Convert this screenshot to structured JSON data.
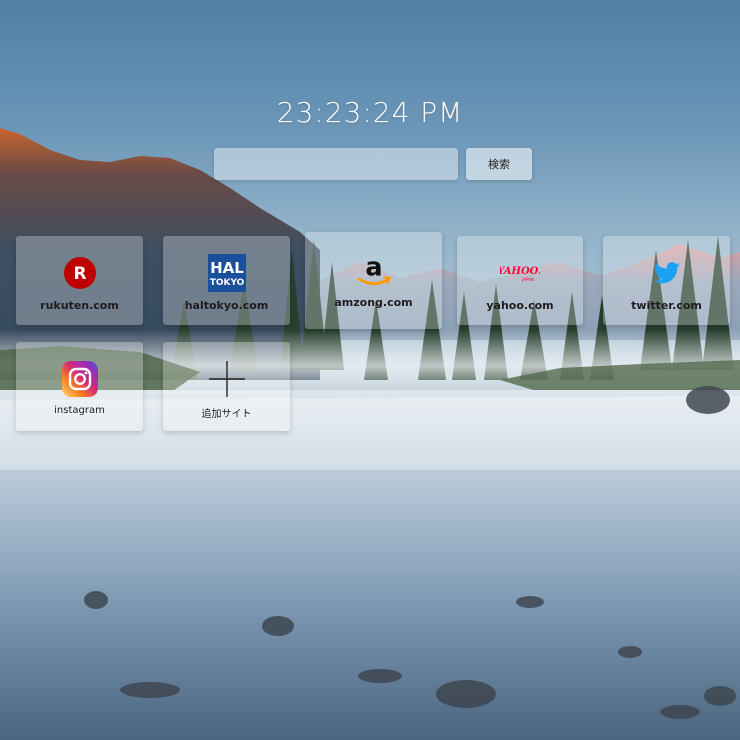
{
  "clock": {
    "time": "23:23:24 PM"
  },
  "search": {
    "placeholder": "",
    "value": "",
    "button_label": "検索"
  },
  "tiles": [
    {
      "label": "rukuten.com",
      "icon": "rakuten-icon",
      "color": "#bf0000"
    },
    {
      "label": "haltokyo.com",
      "icon": "hal-tokyo-icon",
      "color": "#1a4f9c",
      "icon_text_1": "HAL",
      "icon_text_2": "TOKYO"
    },
    {
      "label": "amzong.com",
      "icon": "amazon-icon",
      "color": "#111111"
    },
    {
      "label": "yahoo.com",
      "icon": "yahoo-japan-icon",
      "color": "#ff0033"
    },
    {
      "label": "twitter.com",
      "icon": "twitter-icon",
      "color": "#1da1f2"
    },
    {
      "label": "instagram",
      "icon": "instagram-icon",
      "color": "#c13584"
    },
    {
      "label": "追加サイト",
      "icon": "plus-icon",
      "color": "#222222"
    }
  ]
}
